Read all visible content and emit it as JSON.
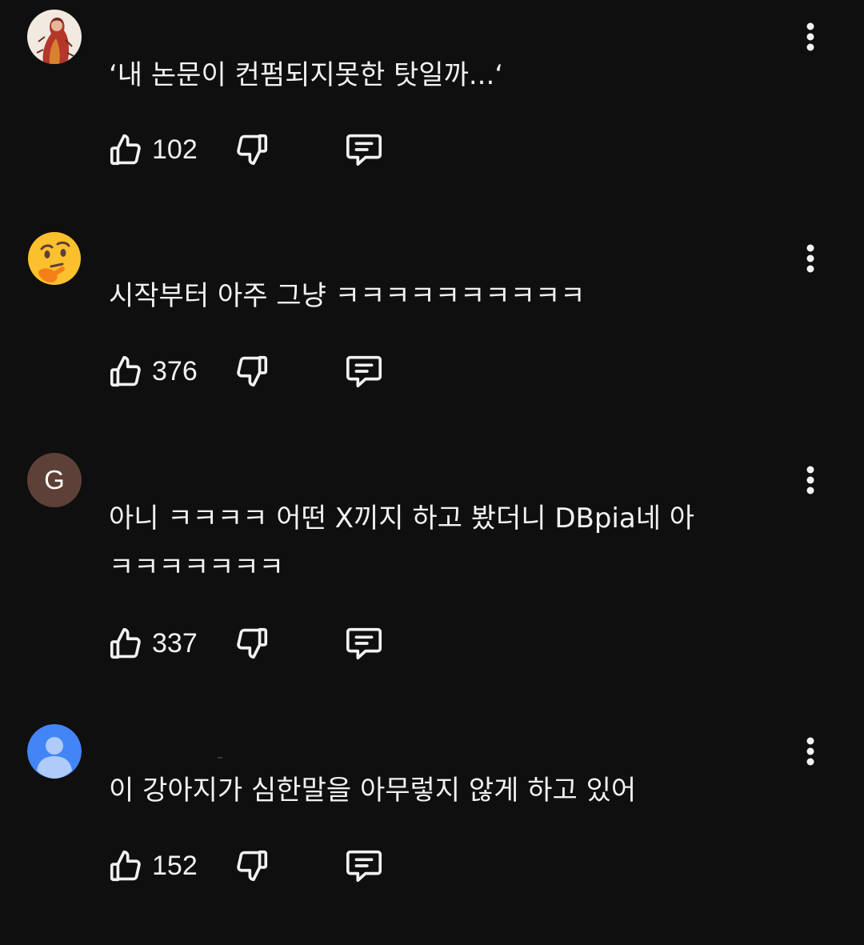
{
  "comments": [
    {
      "avatar": {
        "kind": "image",
        "icon": "illustrated-figure-avatar",
        "colors": [
          "#f2e9e1",
          "#b5362a",
          "#d9812f",
          "#6b2b1f"
        ]
      },
      "text": "‘내 논문이 컨펌되지못한 탓일까...‘",
      "likes": "102"
    },
    {
      "avatar": {
        "kind": "emoji",
        "icon": "thinking-face-emoji-avatar",
        "colors": [
          "#fbc02d",
          "#f57f17"
        ]
      },
      "text": "시작부터 아주 그냥 ㅋㅋㅋㅋㅋㅋㅋㅋㅋㅋ",
      "likes": "376"
    },
    {
      "avatar": {
        "kind": "letter",
        "letter": "G",
        "icon": "letter-avatar",
        "colors": [
          "#5d4037"
        ]
      },
      "text": "아니 ㅋㅋㅋㅋ 어떤 X끼지 하고 봤더니 DBpia네 아 ㅋㅋㅋㅋㅋㅋㅋ",
      "likes": "337"
    },
    {
      "avatar": {
        "kind": "default",
        "icon": "default-user-avatar",
        "colors": [
          "#4285f4",
          "#aecbfa"
        ]
      },
      "text": "이 강아지가 심한말을 아무렇지 않게 하고 있어",
      "likes": "152"
    }
  ],
  "icons": {
    "like": "thumbs-up-icon",
    "dislike": "thumbs-down-icon",
    "reply": "comment-reply-icon",
    "more": "more-vertical-icon"
  },
  "colors": {
    "background": "#0f0f0f",
    "text": "#f1f1f1"
  }
}
